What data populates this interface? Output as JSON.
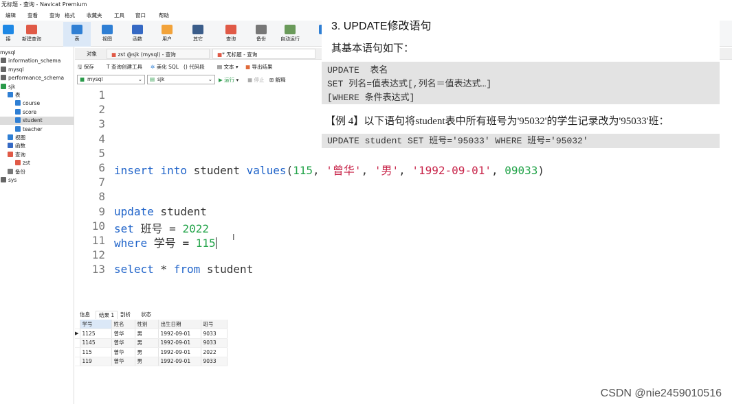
{
  "window": {
    "title": "无标题 - 查询 - Navicat Premium"
  },
  "menu": [
    "编辑",
    "查看",
    "查询",
    "格式",
    "收藏夹",
    "工具",
    "窗口",
    "帮助"
  ],
  "toolbar": [
    {
      "label": "接",
      "color": "#1e88e5"
    },
    {
      "label": "新建查询",
      "color": "#e05a47"
    },
    {
      "label": "表",
      "color": "#2f7fd4"
    },
    {
      "label": "视图",
      "color": "#2f7fd4"
    },
    {
      "label": "函数",
      "color": "#3569c4"
    },
    {
      "label": "用户",
      "color": "#f2a33a"
    },
    {
      "label": "其它",
      "color": "#3b5d8a"
    },
    {
      "label": "查询",
      "color": "#e05a47"
    },
    {
      "label": "备份",
      "color": "#777777"
    },
    {
      "label": "自动运行",
      "color": "#6a9a5a"
    },
    {
      "label": "模",
      "color": "#2f7fd4"
    }
  ],
  "sidebar": {
    "items": [
      {
        "label": "mysql",
        "indent": 0,
        "icon": "connection"
      },
      {
        "label": "information_schema",
        "indent": 0,
        "icon": "database"
      },
      {
        "label": "mysql",
        "indent": 0,
        "icon": "database"
      },
      {
        "label": "performance_schema",
        "indent": 0,
        "icon": "database"
      },
      {
        "label": "sjk",
        "indent": 0,
        "icon": "database-open"
      },
      {
        "label": "表",
        "indent": 1,
        "icon": "table"
      },
      {
        "label": "course",
        "indent": 2,
        "icon": "table"
      },
      {
        "label": "score",
        "indent": 2,
        "icon": "table"
      },
      {
        "label": "student",
        "indent": 2,
        "icon": "table",
        "selected": true
      },
      {
        "label": "teacher",
        "indent": 2,
        "icon": "table"
      },
      {
        "label": "视图",
        "indent": 1,
        "icon": "view"
      },
      {
        "label": "函数",
        "indent": 1,
        "icon": "function"
      },
      {
        "label": "查询",
        "indent": 1,
        "icon": "query"
      },
      {
        "label": "zst",
        "indent": 2,
        "icon": "query"
      },
      {
        "label": "备份",
        "indent": 1,
        "icon": "backup"
      },
      {
        "label": "sys",
        "indent": 0,
        "icon": "database"
      }
    ]
  },
  "tabs": {
    "objects": "对象",
    "tab1": "zst @sjk (mysql) - 查询",
    "tab2": "* 无标题 - 查询"
  },
  "querytools": {
    "save": "保存",
    "builder": "查询创建工具",
    "beautify": "美化 SQL",
    "snippet": "() 代码段",
    "text": "文本",
    "export": "导出结果",
    "run": "▶ 运行",
    "stop": "停止",
    "explain": "解释"
  },
  "selectors": {
    "connection": "mysql",
    "database": "sjk"
  },
  "editor": {
    "lines": [
      [],
      [],
      [],
      [],
      [],
      [
        {
          "t": "insert",
          "c": "kw"
        },
        {
          "t": " "
        },
        {
          "t": "into",
          "c": "kw"
        },
        {
          "t": " student "
        },
        {
          "t": "values",
          "c": "kw"
        },
        {
          "t": "("
        },
        {
          "t": "115",
          "c": "num"
        },
        {
          "t": ", "
        },
        {
          "t": "'曾华'",
          "c": "str"
        },
        {
          "t": ", "
        },
        {
          "t": "'男'",
          "c": "str"
        },
        {
          "t": ", "
        },
        {
          "t": "'1992-09-01'",
          "c": "str"
        },
        {
          "t": ", "
        },
        {
          "t": "09033",
          "c": "num"
        },
        {
          "t": ")"
        }
      ],
      [],
      [],
      [
        {
          "t": "update",
          "c": "kw"
        },
        {
          "t": " student"
        }
      ],
      [
        {
          "t": "set",
          "c": "kw"
        },
        {
          "t": " 班号 = "
        },
        {
          "t": "2022",
          "c": "num"
        }
      ],
      [
        {
          "t": "where",
          "c": "kw"
        },
        {
          "t": " 学号 = "
        },
        {
          "t": "115",
          "c": "num"
        }
      ],
      [],
      [
        {
          "t": "select",
          "c": "kw"
        },
        {
          "t": " * "
        },
        {
          "t": "from",
          "c": "kw"
        },
        {
          "t": " student"
        }
      ]
    ]
  },
  "results": {
    "tabs": [
      "信息",
      "结果 1",
      "剖析",
      "状态"
    ],
    "active_tab": 1,
    "columns": [
      "学号",
      "姓名",
      "性别",
      "出生日期",
      "班号"
    ],
    "rows": [
      [
        "1125",
        "曾华",
        "男",
        "1992-09-01",
        "9033"
      ],
      [
        "1145",
        "曾华",
        "男",
        "1992-09-01",
        "9033"
      ],
      [
        "115",
        "曾华",
        "男",
        "1992-09-01",
        "2022"
      ],
      [
        "119",
        "曾华",
        "男",
        "1992-09-01",
        "9033"
      ]
    ]
  },
  "overlay": {
    "title": "3. UPDATE修改语句",
    "subtitle": "其基本语句如下：",
    "syntax": [
      "UPDATE  表名",
      "SET 列名=值表达式[,列名＝值表达式…]",
      "[WHERE 条件表达式]"
    ],
    "example": "【例 4】以下语句将student表中所有班号为'95032'的学生记录改为'95033'班：",
    "example_code": "UPDATE student SET 班号='95033' WHERE 班号='95032'"
  },
  "watermark": "CSDN @nie2459010516"
}
